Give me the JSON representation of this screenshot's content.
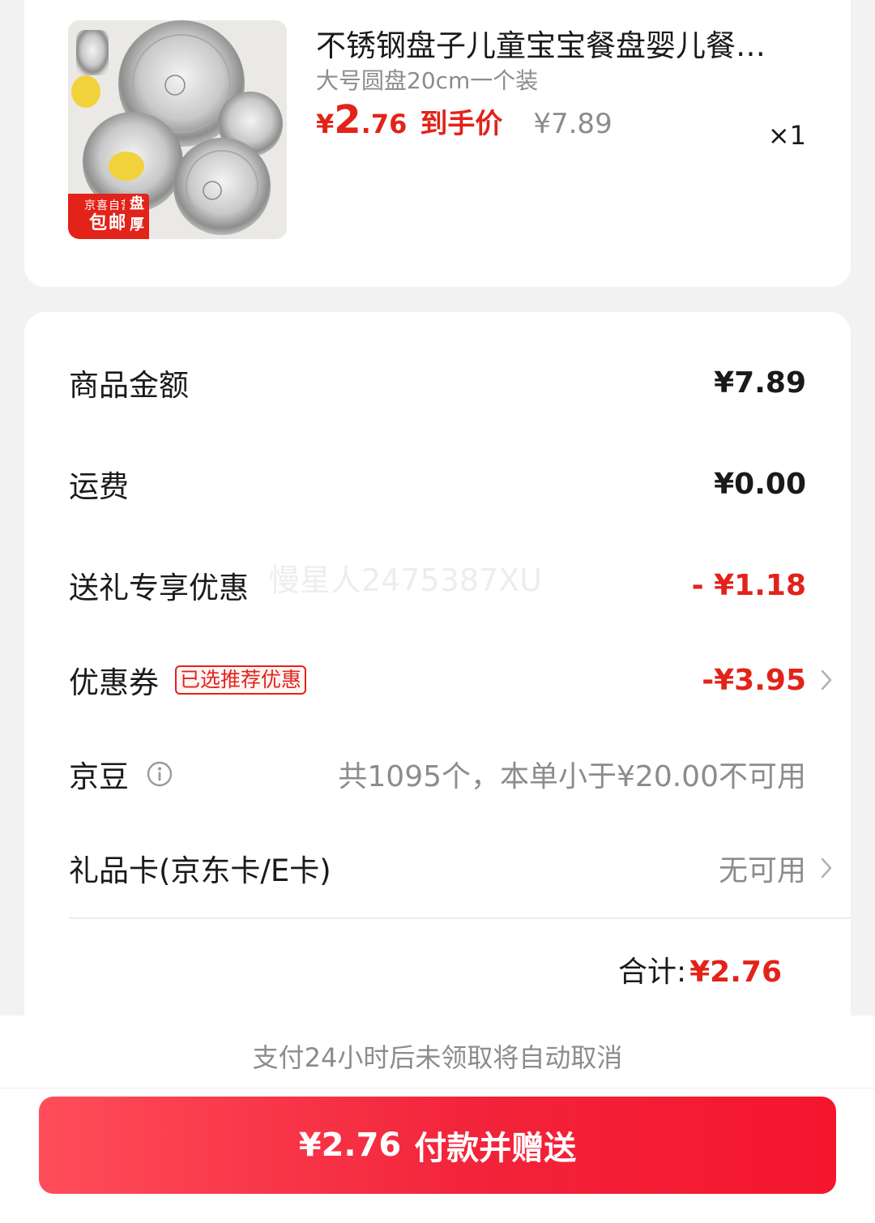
{
  "product": {
    "title": "不锈钢盘子儿童宝宝餐盘婴儿餐…",
    "spec": "大号圆盘20cm一个装",
    "price_currency": "¥",
    "price_int": "2",
    "price_dec": ".76",
    "price_label": "到手价",
    "original_price": "¥7.89",
    "quantity": "×1",
    "image_badge_top": "京喜自营",
    "image_badge_bottom": "包邮",
    "image_tag_1": "盘",
    "image_tag_2": "厚"
  },
  "summary": {
    "rows": [
      {
        "label": "商品金额",
        "value": "¥7.89"
      },
      {
        "label": "运费",
        "value": "¥0.00"
      },
      {
        "label": "送礼专享优惠",
        "value": "- ¥1.18"
      },
      {
        "label": "优惠券",
        "tag": "已选推荐优惠",
        "value": "-¥3.95"
      },
      {
        "label": "京豆",
        "value": "共1095个，本单小于¥20.00不可用"
      },
      {
        "label": "礼品卡(京东卡/E卡)",
        "value": "无可用"
      }
    ],
    "total_label": "合计:",
    "total_value": "¥2.76"
  },
  "watermark": "慢星人2475387XU",
  "footer": {
    "notice": "支付24小时后未领取将自动取消",
    "pay_amount": "¥2.76",
    "pay_label": "付款并赠送"
  },
  "colors": {
    "accent_red": "#e2231a",
    "button_red": "#f2233a",
    "muted_text": "#8c8c8c",
    "page_background": "#f2f2f2"
  },
  "icons": {
    "chevron": "chevron-right-icon",
    "info": "info-icon"
  }
}
